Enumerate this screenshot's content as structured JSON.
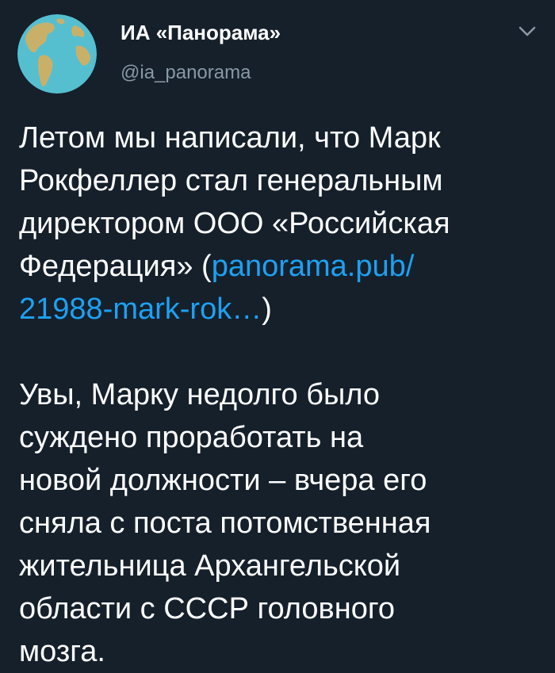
{
  "author": {
    "display_name": "ИА «Панорама»",
    "handle": "@ia_panorama",
    "avatar_icon": "globe-icon"
  },
  "menu": {
    "icon": "chevron-down-icon"
  },
  "tweet": {
    "paragraph1": {
      "line1": "Летом мы написали, что Марк",
      "line2": "Рокфеллер стал генеральным",
      "line3": "директором ООО «Российская",
      "line4_prefix": "Федерация» (",
      "link_part1": "panorama.pub/",
      "link_part2": "21988-mark-rok…",
      "line5_suffix": ")"
    },
    "paragraph2": {
      "line1": "Увы, Марку недолго было",
      "line2": "суждено проработать на",
      "line3": "новой должности – вчера его",
      "line4": "сняла с поста потомственная",
      "line5": "жительница Архангельской",
      "line6": "области с СССР головного",
      "line7": "мозга."
    }
  },
  "colors": {
    "background": "#15202b",
    "text": "#ffffff",
    "secondary_text": "#8899a6",
    "link": "#1da1f2",
    "globe_ocean": "#55bfd0",
    "globe_land": "#c9b069"
  }
}
